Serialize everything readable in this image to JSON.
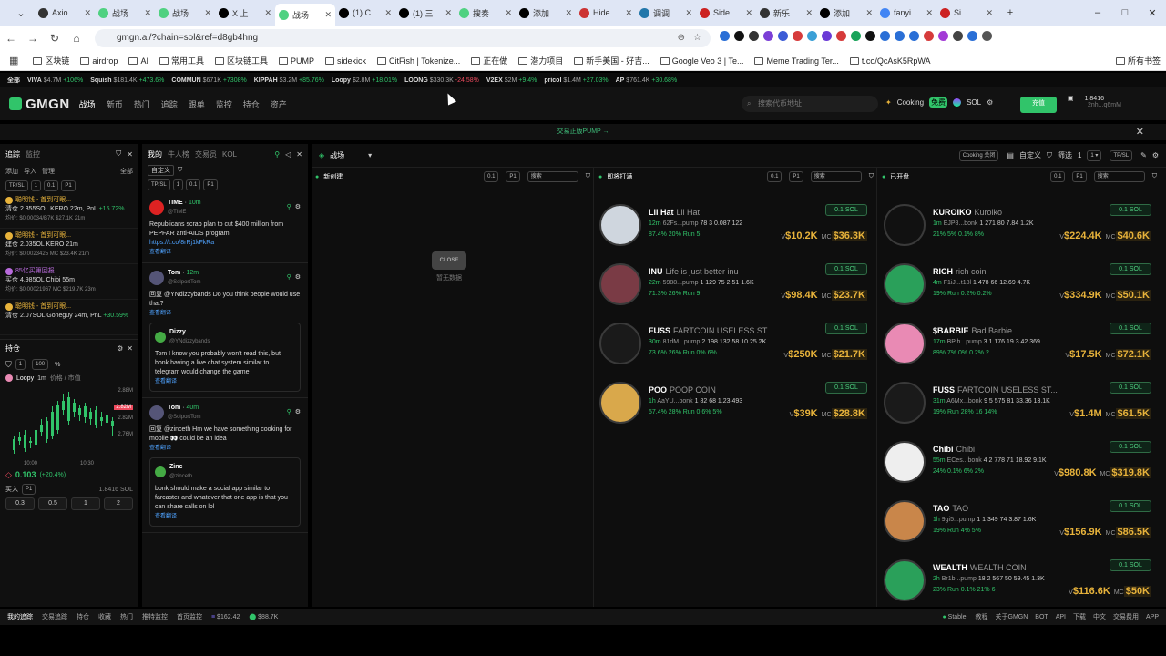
{
  "browser": {
    "tabs": [
      {
        "label": "Axio",
        "fav": "#333"
      },
      {
        "label": "战场",
        "fav": "#4fd181"
      },
      {
        "label": "战场",
        "fav": "#4fd181"
      },
      {
        "label": "X 上",
        "fav": "#000"
      },
      {
        "label": "战场",
        "fav": "#4fd181",
        "active": true
      },
      {
        "label": "(1) C",
        "fav": "#000"
      },
      {
        "label": "(1) 三",
        "fav": "#000"
      },
      {
        "label": "搜奏",
        "fav": "#4fd181"
      },
      {
        "label": "添加",
        "fav": "#000"
      },
      {
        "label": "Hide",
        "fav": "#c33"
      },
      {
        "label": "调调",
        "fav": "#27a"
      },
      {
        "label": "Side",
        "fav": "#c22"
      },
      {
        "label": "新乐",
        "fav": "#333"
      },
      {
        "label": "添加",
        "fav": "#000"
      },
      {
        "label": "fanyi",
        "fav": "#4285f4"
      },
      {
        "label": "Si",
        "fav": "#c22"
      }
    ],
    "url": "gmgn.ai/?chain=sol&ref=d8gb4hng",
    "bookmarks": [
      "区块链",
      "airdrop",
      "AI",
      "常用工具",
      "区块链工具",
      "PUMP",
      "sidekick",
      "CitFish | Tokenize...",
      "正在做",
      "潜力项目",
      "新手美国 - 好吉...",
      "Google Veo 3 | Te...",
      "Meme Trading Ter...",
      "t.co/QcAsK5RpWA"
    ],
    "bookmarks_all": "所有书签"
  },
  "ticker": [
    {
      "name": "全部",
      "val": "",
      "chg": "",
      "color": "#ddd"
    },
    {
      "name": "VIVA",
      "val": "$4.7M",
      "chg": "+106%",
      "color": "#31c46a"
    },
    {
      "name": "Squish",
      "val": "$181.4K",
      "chg": "+473.6%",
      "color": "#31c46a"
    },
    {
      "name": "COMMUN",
      "val": "$671K",
      "chg": "+7308%",
      "color": "#31c46a"
    },
    {
      "name": "KIPPAH",
      "val": "$3.2M",
      "chg": "+85.76%",
      "color": "#31c46a"
    },
    {
      "name": "Loopy",
      "val": "$2.8M",
      "chg": "+18.01%",
      "color": "#31c46a"
    },
    {
      "name": "LOONG",
      "val": "$330.3K",
      "chg": "-24.58%",
      "color": "#ee4b5e"
    },
    {
      "name": "V2EX",
      "val": "$2M",
      "chg": "+9.4%",
      "color": "#31c46a"
    },
    {
      "name": "pricol",
      "val": "$1.4M",
      "chg": "+27.03%",
      "color": "#31c46a"
    },
    {
      "name": "AP",
      "val": "$761.4K",
      "chg": "+30.68%",
      "color": "#31c46a"
    }
  ],
  "header": {
    "logo": "GMGN",
    "menu": [
      "战场",
      "新币",
      "热门",
      "追踪",
      "跟单",
      "监控",
      "持仓",
      "资产"
    ],
    "search_placeholder": "搜索代币地址",
    "cooking": "Cooking",
    "cooking_badge": "免费",
    "chain": "SOL",
    "deposit": "充值",
    "balance": "1.8416",
    "address": "2nh...q6mM"
  },
  "banner": "交易正版PUMP →",
  "left": {
    "tabs": [
      "追踪",
      "监控"
    ],
    "subtabs": [
      "添加",
      "导入",
      "管理",
      "全部"
    ],
    "items": [
      {
        "name": "聪明钱 - 首到可眼...",
        "line": "清仓 2.355SOL KERO 22m, PnL",
        "extra": "+15.72%",
        "meta": "均价: $0.00034/B7K $27.1K 21m",
        "color": "#e8b33b"
      },
      {
        "name": "聪明钱 - 首到可眼...",
        "line": "建仓 2.035OL KERO 21m",
        "extra": "",
        "meta": "均价: $0.0023425 MC $23.4K 21m",
        "color": "#e8b33b"
      },
      {
        "name": "85亿买第回报...",
        "line": "买仓 4.985OL Chibi 55m",
        "extra": "",
        "meta": "均价: $0.00021967 MC $219.7K 23m",
        "color": "#b96bdc"
      },
      {
        "name": "聪明钱 - 首到可眼...",
        "line": "清仓 2.07SOL Goneguy 24m, PnL",
        "extra": "+30.59%",
        "meta": "",
        "color": "#e8b33b"
      }
    ],
    "holdings_title": "持仓",
    "holdings_token": "Loopy",
    "holdings_timeframe": "1m",
    "holdings_price_label": "价格 / 市值",
    "chart_prices": [
      "2.88M",
      "2.82M",
      "2.82M",
      "2.76M"
    ],
    "chart_times": [
      "10:00",
      "10:30"
    ],
    "pnl": "0.103",
    "pnl_pct": "(+20.4%)",
    "buy_label": "买入",
    "sol_balance": "1.8416 SOL",
    "amounts": [
      "0.3",
      "0.5",
      "1",
      "2"
    ],
    "tab_mode": "TP/SL",
    "qty": "100",
    "qty_unit": "%"
  },
  "feed": {
    "tabs": [
      "我的",
      "牛人榜",
      "交易员",
      "KOL"
    ],
    "filter": "自定义",
    "tweets": [
      {
        "user": "TIME",
        "time": "10m",
        "handle": "@TIME",
        "text": "Republicans scrap plan to cut $400 million from PEPFAR anti-AIDS program",
        "link": "https://t.co/8rRj1kFkRa",
        "translate": "查看翻译",
        "color": "#d22"
      },
      {
        "user": "Tom",
        "time": "12m",
        "handle": "@SolportTom",
        "text": "回复 @YNdizzybands Do you think people would use that?",
        "translate": "查看翻译",
        "color": "#557",
        "quote": {
          "user": "Dizzy",
          "handle": "@YNdizzybands",
          "text": "Tom I know you probably won't read this, but bonk having a live chat system similar to telegram would change the game",
          "translate": "查看翻译"
        }
      },
      {
        "user": "Tom",
        "time": "40m",
        "handle": "@SolportTom",
        "text": "回复 @zinceth Hm we have something cooking for mobile 👀 could be an idea",
        "translate": "查看翻译",
        "color": "#557",
        "quote": {
          "user": "Zinc",
          "handle": "@zinceth",
          "text": "bonk should make a social app similar to farcaster and whatever that one app is that you can share calls on lol",
          "translate": "查看翻译"
        }
      }
    ]
  },
  "main": {
    "title": "战场",
    "cols": [
      {
        "title": "新创建",
        "empty_label": "暂无数据",
        "close_label": "CLOSE",
        "amount": "0.1",
        "preset": "P1",
        "search": "搜索"
      },
      {
        "title": "即将打满",
        "amount": "0.1",
        "preset": "P1",
        "search": "搜索"
      },
      {
        "title": "已开盘",
        "amount": "0.1",
        "preset": "P1",
        "search": "搜索"
      }
    ],
    "toolbar": {
      "cooking_off": "Cooking 关闭",
      "custom_filter": "自定义",
      "filter": "筛选",
      "filter_count": "1",
      "preset_count": "1",
      "mode": "TP/SL"
    },
    "buy_label": "0.1 SOL",
    "tokens_mid": [
      {
        "sym": "Lil Hat",
        "name": "Lil Hat",
        "age": "12m",
        "addr": "62Fs...pump",
        "stats": "78 3 0.087 122",
        "pcts": "87.4% 20% Run 5",
        "vol": "$10.2K",
        "mc": "$36.3K",
        "bg": "#cfd6de"
      },
      {
        "sym": "INU",
        "name": "Life is just better inu",
        "age": "22m",
        "addr": "5988...pump",
        "stats": "1 129 75 2.51 1.6K",
        "pcts": "71.3% 26% Run 9",
        "vol": "$98.4K",
        "mc": "$23.7K",
        "bg": "#7a3b45"
      },
      {
        "sym": "FUSS",
        "name": "FARTCOIN USELESS ST...",
        "age": "30m",
        "addr": "81dM...pump",
        "stats": "2 198 132 58 10.25 2K",
        "pcts": "73.6% 26% Run 0% 6%",
        "vol": "$250K",
        "mc": "$21.7K",
        "bg": "#1a1a1a"
      },
      {
        "sym": "POO",
        "name": "POOP COIN",
        "age": "1h",
        "addr": "AaYU...bonk",
        "stats": "1 82 68 1.23 493",
        "pcts": "57.4% 28% Run 0.6% 5%",
        "vol": "$39K",
        "mc": "$28.8K",
        "bg": "#d9a84b"
      }
    ],
    "tokens_right": [
      {
        "sym": "KUROIKO",
        "name": "Kuroiko",
        "age": "1m",
        "addr": "EJP8...bonk",
        "stats": "1 271 80 7.84 1.2K",
        "pcts": "21% 5% 0.1% 8%",
        "vol": "$224.4K",
        "mc": "$40.6K",
        "bg": "#111"
      },
      {
        "sym": "RICH",
        "name": "rich coin",
        "age": "4m",
        "addr": "F1iJ...t18l",
        "stats": "1 478 66 12.69 4.7K",
        "pcts": "19% Run 0.2% 0.2%",
        "vol": "$334.9K",
        "mc": "$50.1K",
        "bg": "#2aa05a"
      },
      {
        "sym": "$BARBIE",
        "name": "Bad Barbie",
        "age": "17m",
        "addr": "BPih...pump",
        "stats": "3 1 176 19 3.42 369",
        "pcts": "89% 7% 0% 0.2% 2",
        "vol": "$17.5K",
        "mc": "$72.1K",
        "bg": "#e98ab4"
      },
      {
        "sym": "FUSS",
        "name": "FARTCOIN USELESS ST...",
        "age": "31m",
        "addr": "A6Mx...bonk",
        "stats": "9 5 575 81 33.36 13.1K",
        "pcts": "19% Run 28% 16 14%",
        "vol": "$1.4M",
        "mc": "$61.5K",
        "bg": "#1a1a1a"
      },
      {
        "sym": "Chibi",
        "name": "Chibi",
        "age": "55m",
        "addr": "ECes...bonk",
        "stats": "4 2 778 71 18.92 9.1K",
        "pcts": "24% 0.1% 6% 2%",
        "vol": "$980.8K",
        "mc": "$319.8K",
        "bg": "#eee"
      },
      {
        "sym": "TAO",
        "name": "TAO",
        "age": "1h",
        "addr": "9gi5...pump",
        "stats": "1 1 349 74 3.87 1.6K",
        "pcts": "19% Run 4% 5%",
        "vol": "$156.9K",
        "mc": "$86.5K",
        "bg": "#c9864a"
      },
      {
        "sym": "WEALTH",
        "name": "WEALTH COIN",
        "age": "2h",
        "addr": "Br1b...pump",
        "stats": "18 2 567 50 59.45 1.3K",
        "pcts": "23% Run 0.1% 21% 6",
        "vol": "$116.6K",
        "mc": "$50K",
        "bg": "#2aa05a"
      }
    ]
  },
  "status": {
    "items": [
      "我的追踪",
      "交易追踪",
      "持仓",
      "收藏",
      "热门",
      "推特监控",
      "首页监控"
    ],
    "sol_price": "$162.42",
    "vol": "$88.7K",
    "stable": "Stable",
    "right": [
      "教程",
      "关于GMGN",
      "BOT",
      "API",
      "下载",
      "中文",
      "交易费用",
      "APP"
    ]
  },
  "colors": {
    "accent": "#31c46a",
    "negative": "#ee4b5e",
    "bg": "#101010"
  }
}
